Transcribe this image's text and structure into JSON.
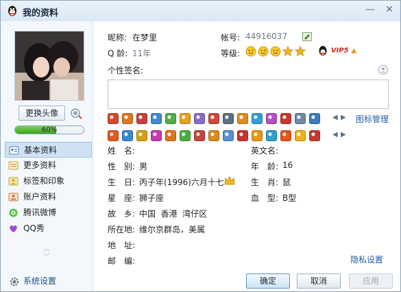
{
  "window": {
    "title": "我的资料",
    "minimize_glyph": "—",
    "close_glyph": "✕"
  },
  "sidebar": {
    "change_avatar_label": "更换头像",
    "progress_text": "60%",
    "progress_value": 0.6,
    "nav_items": [
      {
        "label": "基本资料",
        "icon": "id-card-icon",
        "color": "#4a7fc2"
      },
      {
        "label": "更多资料",
        "icon": "document-list-icon",
        "color": "#d49a2c"
      },
      {
        "label": "标签和印象",
        "icon": "tag-person-icon",
        "color": "#c9a234"
      },
      {
        "label": "账户资料",
        "icon": "account-icon",
        "color": "#c67a3a"
      },
      {
        "label": "腾讯微博",
        "icon": "weibo-icon",
        "color": "#4fae46"
      },
      {
        "label": "QQ秀",
        "icon": "qq-show-icon",
        "color": "#a24ad1"
      }
    ],
    "system_settings_label": "系统设置"
  },
  "profile": {
    "nickname_label": "昵称:",
    "nickname_value": "在梦里",
    "account_label": "帐号:",
    "account_value": "44916037",
    "qage_label": "Q 龄:",
    "qage_value": "11年",
    "level_label": "等级:",
    "vip_text": "VIP5",
    "signature_label": "个性签名:",
    "icon_manage_label": "图标管理"
  },
  "details": {
    "name_label": "姓　名:",
    "english_name_label": "英文名:",
    "gender_label": "性　别:",
    "gender_value": "男",
    "age_label": "年　龄:",
    "age_value": "16",
    "birthday_label": "生　日:",
    "birthday_value": "丙子年(1996)六月十七",
    "zodiac_label": "生　肖:",
    "zodiac_value": "鼠",
    "constellation_label": "星　座:",
    "constellation_value": "狮子座",
    "blood_label": "血　型:",
    "blood_value": "B型",
    "hometown_label": "故　乡:",
    "hometown_value": "中国  香港  湾仔区",
    "location_label": "所在地:",
    "location_value": "维尔京群岛，美属",
    "address_label": "地　址:",
    "postcode_label": "邮　编:",
    "privacy_label": "隐私设置"
  },
  "footer": {
    "ok_label": "确定",
    "cancel_label": "取消",
    "apply_label": "应用"
  },
  "colors": {
    "accent": "#1f5fa8",
    "progress": "#3aa11d"
  }
}
